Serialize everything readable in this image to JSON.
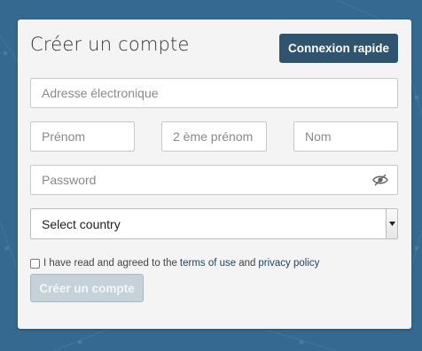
{
  "colors": {
    "background": "#35698f",
    "card": "#f4f4f4",
    "primary_button": "#2f5470",
    "disabled_button": "#c5d2da",
    "link": "#1f3f5e"
  },
  "form": {
    "title": "Créer un compte",
    "quick_login_label": "Connexion rapide",
    "email": {
      "placeholder": "Adresse électronique",
      "value": ""
    },
    "first_name": {
      "placeholder": "Prénom",
      "value": ""
    },
    "middle_name": {
      "placeholder": "2 ème prénom",
      "value": ""
    },
    "last_name": {
      "placeholder": "Nom",
      "value": ""
    },
    "password": {
      "placeholder": "Password",
      "value": "",
      "toggle_icon": "eye-slash-icon"
    },
    "country": {
      "selected": "Select country"
    },
    "terms": {
      "checked": false,
      "prefix": "I have read and agreed to the",
      "terms_link": "terms of use",
      "and": "and",
      "privacy_link": "privacy policy"
    },
    "submit_label": "Créer un compte"
  }
}
